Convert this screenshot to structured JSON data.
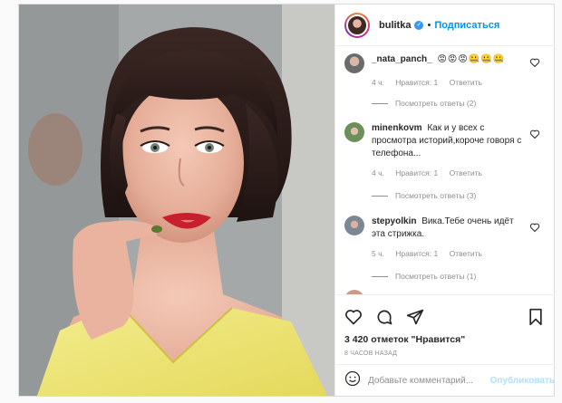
{
  "post": {
    "author": {
      "username": "bulitka",
      "verified": true,
      "separator": "•",
      "follow_label": "Подписаться"
    },
    "comments": [
      {
        "username": "_nata_panch_",
        "text": "😡😡😡🤐🤐🤐",
        "time": "4 ч.",
        "likes": "Нравится: 1",
        "reply_label": "Ответить",
        "view_replies": "Посмотреть ответы (2)"
      },
      {
        "username": "minenkovm",
        "text": "Как и у всех с просмотра историй,короче говоря с телефона...",
        "time": "4 ч.",
        "likes": "Нравится: 1",
        "reply_label": "Ответить",
        "view_replies": "Посмотреть ответы (3)"
      },
      {
        "username": "stepyolkin",
        "text": "Вика.Тебе очень идёт эта стрижка.",
        "time": "5 ч.",
        "likes": "Нравится: 1",
        "reply_label": "Ответить",
        "view_replies": "Посмотреть ответы (1)"
      }
    ],
    "likes_text": "3 420 отметок \"Нравится\"",
    "timestamp": "8 часов назад",
    "add_comment": {
      "placeholder": "Добавьте комментарий...",
      "publish_label": "Опубликовать"
    }
  },
  "icons": [
    "heart-icon",
    "comment-icon",
    "share-icon",
    "bookmark-icon",
    "emoji-icon",
    "verified-icon"
  ],
  "colors": {
    "accent": "#0095f6",
    "verified": "#3897f0",
    "publish_disabled": "#b2dffc",
    "meta": "#8e8e8e"
  }
}
